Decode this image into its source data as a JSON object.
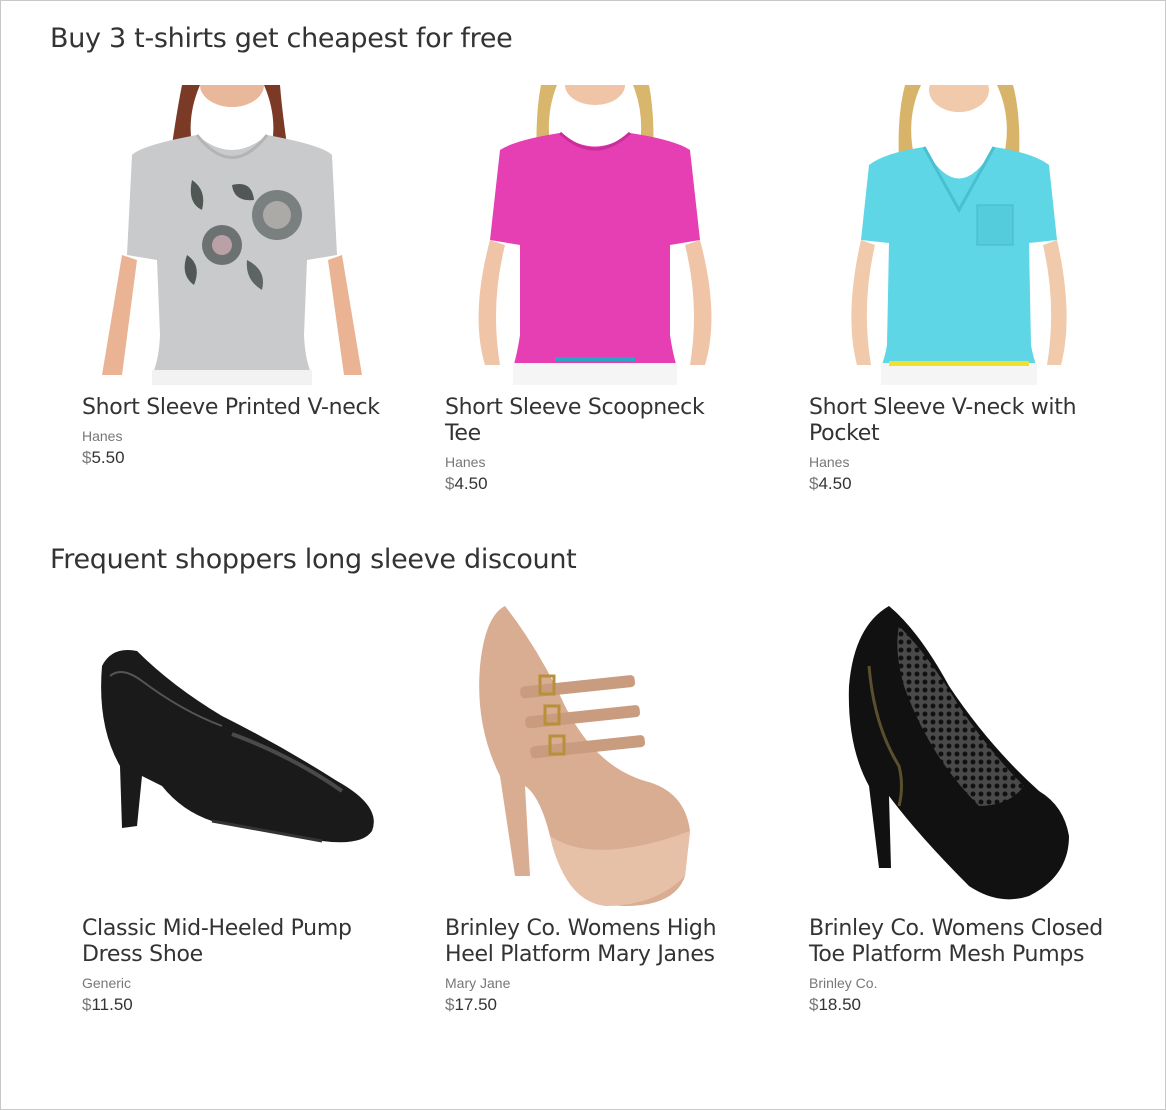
{
  "sections": [
    {
      "title": "Buy 3 t-shirts get cheapest for free",
      "products": [
        {
          "name": "Short Sleeve Printed V-neck",
          "brand": "Hanes",
          "currency": "$",
          "amount": "5.50",
          "image": "gray-floral-tshirt",
          "color": "#c9cacc"
        },
        {
          "name": "Short Sleeve Scoopneck Tee",
          "brand": "Hanes",
          "currency": "$",
          "amount": "4.50",
          "image": "pink-tshirt",
          "color": "#e63fb4"
        },
        {
          "name": "Short Sleeve V-neck with Pocket",
          "brand": "Hanes",
          "currency": "$",
          "amount": "4.50",
          "image": "turquoise-tshirt",
          "color": "#5fd6e6"
        }
      ]
    },
    {
      "title": "Frequent shoppers long sleeve discount",
      "products": [
        {
          "name": "Classic Mid-Heeled Pump Dress Shoe",
          "brand": "Generic",
          "currency": "$",
          "amount": "11.50",
          "image": "black-pump",
          "color": "#1a1a1a"
        },
        {
          "name": "Brinley Co. Womens High Heel Platform Mary Janes",
          "brand": "Mary Jane",
          "currency": "$",
          "amount": "17.50",
          "image": "nude-mary-jane",
          "color": "#d9ad92"
        },
        {
          "name": "Brinley Co. Womens Closed Toe Platform Mesh Pumps",
          "brand": "Brinley Co.",
          "currency": "$",
          "amount": "18.50",
          "image": "black-mesh-pump",
          "color": "#111111"
        }
      ]
    }
  ]
}
